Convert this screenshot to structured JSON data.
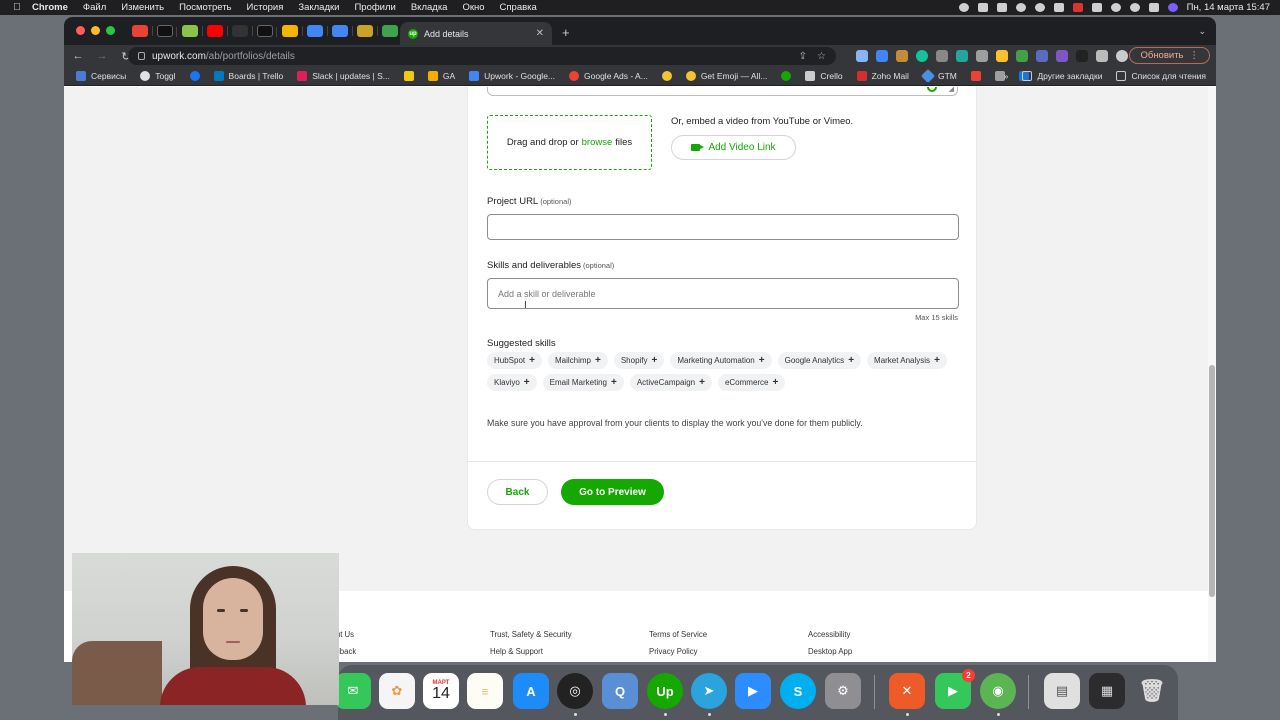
{
  "menubar": {
    "app": "Chrome",
    "items": [
      "Файл",
      "Изменить",
      "Посмотреть",
      "История",
      "Закладки",
      "Профили",
      "Вкладка",
      "Окно",
      "Справка"
    ],
    "clock": "Пн, 14 марта  15:47"
  },
  "tab": {
    "title": "Add details",
    "favicon": "up"
  },
  "address": {
    "host": "upwork.com",
    "path": "/ab/portfolios/details"
  },
  "update_button": "Обновить",
  "bookmarks": {
    "items": [
      {
        "label": "Сервисы",
        "color": "#4a7bd8"
      },
      {
        "label": "Toggl",
        "color": "#e2e2e2"
      },
      {
        "label": "",
        "color": "#1877f2"
      },
      {
        "label": "Boards | Trello",
        "color": "#0079bf"
      },
      {
        "label": "Slack | updates | S...",
        "color": "#e01e5a"
      },
      {
        "label": "",
        "color": "#f2c811"
      },
      {
        "label": "GA",
        "color": "#f9ab00"
      },
      {
        "label": "Upwork - Google...",
        "color": "#4285f4"
      },
      {
        "label": "Google Ads - A...",
        "color": "#ea4335"
      },
      {
        "label": "",
        "color": "#f4c430"
      },
      {
        "label": "Get Emoji — All...",
        "color": "#f4c430"
      },
      {
        "label": "",
        "color": "#14a800"
      },
      {
        "label": "Crello",
        "color": "#cccccc"
      },
      {
        "label": "Zoho Mail",
        "color": "#d32f2f"
      },
      {
        "label": "GTM",
        "color": "#4a90e2"
      },
      {
        "label": "",
        "color": "#ea4335"
      },
      {
        "label": "",
        "color": "#9e9e9e"
      },
      {
        "label": "",
        "color": "#1976d2"
      }
    ],
    "other": "Другие закладки",
    "reading_list": "Список для чтения"
  },
  "form": {
    "dropzone_prefix": "Drag and drop or",
    "dropzone_link": "browse",
    "dropzone_suffix": "files",
    "embed_text": "Or, embed a video from YouTube or Vimeo.",
    "video_button": "Add Video Link",
    "project_url_label": "Project URL",
    "optional": "(optional)",
    "skills_label": "Skills and deliverables",
    "skills_placeholder": "Add a skill or deliverable",
    "max_skills": "Max 15 skills",
    "suggested_label": "Suggested skills",
    "suggested_row1": [
      "HubSpot",
      "Mailchimp",
      "Shopify",
      "Marketing Automation",
      "Google Analytics",
      "Market Analysis"
    ],
    "suggested_row2": [
      "Klaviyo",
      "Email Marketing",
      "ActiveCampaign",
      "eCommerce"
    ],
    "approval_text": "Make sure you have approval from your clients to display the work you've done for them publicly.",
    "back_button": "Back",
    "preview_button": "Go to Preview"
  },
  "footer": {
    "col1": [
      "About Us",
      "Feedback"
    ],
    "col2": [
      "Trust, Safety & Security",
      "Help & Support"
    ],
    "col3": [
      "Terms of Service",
      "Privacy Policy"
    ],
    "col4": [
      "Accessibility",
      "Desktop App"
    ]
  },
  "dock": {
    "calendar_month": "МАРТ",
    "calendar_day": "14",
    "facetime_badge": "2"
  }
}
